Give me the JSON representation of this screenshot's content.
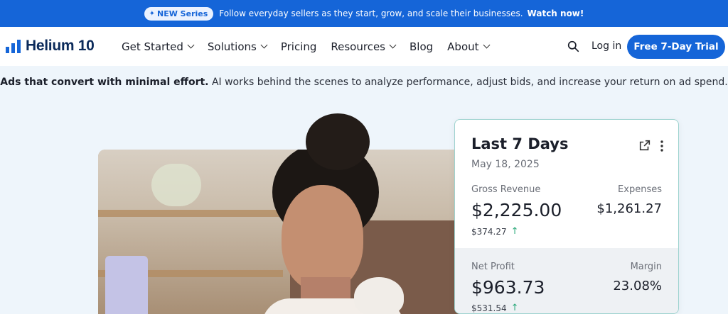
{
  "announcement": {
    "badge": "NEW Series",
    "message": "Follow everyday sellers as they start, grow, and scale their businesses.",
    "cta": "Watch now!"
  },
  "nav": {
    "logo": "Helium 10",
    "items": [
      {
        "label": "Get Started",
        "dropdown": true
      },
      {
        "label": "Solutions",
        "dropdown": true
      },
      {
        "label": "Pricing",
        "dropdown": false
      },
      {
        "label": "Resources",
        "dropdown": true
      },
      {
        "label": "Blog",
        "dropdown": false
      },
      {
        "label": "About",
        "dropdown": true
      }
    ],
    "login": "Log in",
    "trial": "Free 7-Day Trial"
  },
  "tagline": {
    "bold": "Ads that convert with minimal effort.",
    "rest": " AI works behind the scenes to analyze performance, adjust bids, and increase your return on ad spend."
  },
  "card": {
    "title": "Last 7 Days",
    "date": "May 18, 2025",
    "gross_label": "Gross Revenue",
    "gross_value": "$2,225.00",
    "gross_change": "$374.27",
    "expenses_label": "Expenses",
    "expenses_value": "$1,261.27",
    "net_label": "Net Profit",
    "net_value": "$963.73",
    "net_change": "$531.54",
    "margin_label": "Margin",
    "margin_value": "23.08%"
  },
  "colors": {
    "brand": "#1565d8",
    "accent_up": "#2aa87a",
    "card_border": "#9ed3cf"
  },
  "icons": [
    "sparkle-icon",
    "logo-bars-icon",
    "chevron-down-icon",
    "search-icon",
    "external-link-icon",
    "more-vertical-icon",
    "arrow-up-icon"
  ]
}
